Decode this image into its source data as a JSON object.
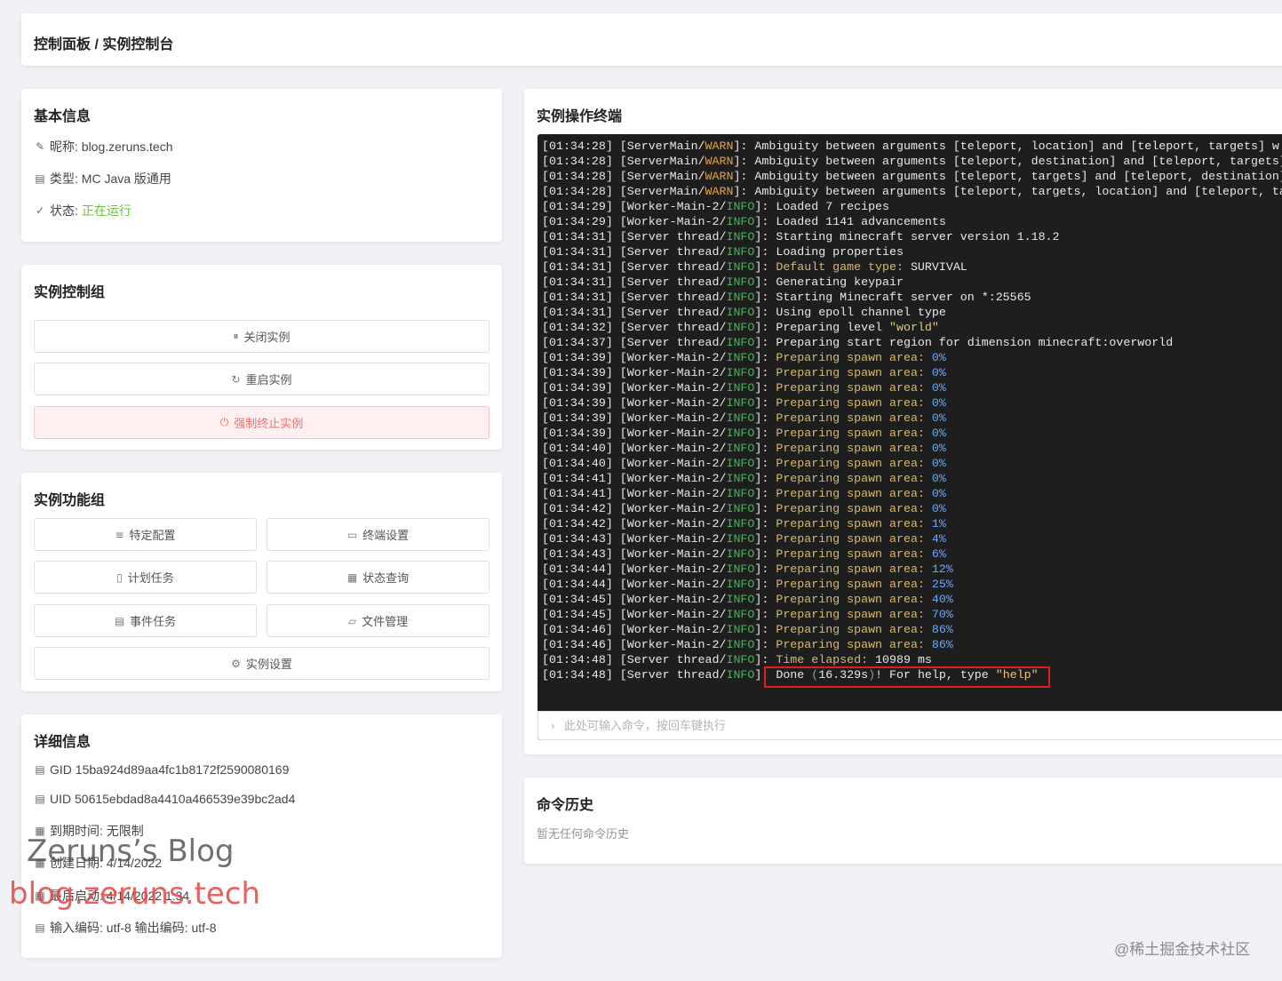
{
  "header": {
    "breadcrumb": "控制面板 / 实例控制台"
  },
  "basic": {
    "title": "基本信息",
    "nickname_label": "昵称: blog.zeruns.tech",
    "type_label": "类型: MC Java 版通用",
    "status_prefix": "状态:",
    "status_value": "正在运行"
  },
  "control": {
    "title": "实例控制组",
    "stop": "关闭实例",
    "restart": "重启实例",
    "kill": "强制终止实例"
  },
  "functions": {
    "title": "实例功能组",
    "items": [
      "特定配置",
      "终端设置",
      "计划任务",
      "状态查询",
      "事件任务",
      "文件管理",
      "实例设置"
    ]
  },
  "detail": {
    "title": "详细信息",
    "gid": "GID 15ba924d89aa4fc1b8172f2590080169",
    "uid": "UID 50615ebdad8a4410a466539e39bc2ad4",
    "expire": "到期时间: 无限制",
    "created": "创建日期: 4/14/2022",
    "last_start": "最后启动: 4/14/2022 1:34",
    "encoding": "输入编码: utf-8 输出编码: utf-8"
  },
  "terminal": {
    "title": "实例操作终端",
    "lines": [
      [
        "[01:34:28]",
        "ServerMain",
        "WARN",
        "Ambiguity between arguments [teleport, location] and [teleport, targets] w",
        "plain"
      ],
      [
        "[01:34:28]",
        "ServerMain",
        "WARN",
        "Ambiguity between arguments [teleport, destination] and [teleport, targets]",
        "plain"
      ],
      [
        "[01:34:28]",
        "ServerMain",
        "WARN",
        "Ambiguity between arguments [teleport, targets] and [teleport, destination]",
        "plain"
      ],
      [
        "[01:34:28]",
        "ServerMain",
        "WARN",
        "Ambiguity between arguments [teleport, targets, location] and [teleport, ta",
        "plain"
      ],
      [
        "[01:34:29]",
        "Worker-Main-2",
        "INFO",
        "Loaded 7 recipes",
        "plain"
      ],
      [
        "[01:34:29]",
        "Worker-Main-2",
        "INFO",
        "Loaded 1141 advancements",
        "plain"
      ],
      [
        "[01:34:31]",
        "Server thread",
        "INFO",
        "Starting minecraft server version 1.18.2",
        "plain"
      ],
      [
        "[01:34:31]",
        "Server thread",
        "INFO",
        "Loading properties",
        "plain"
      ],
      [
        "[01:34:31]",
        "Server thread",
        "INFO",
        "Default game type: |SURVIVAL",
        "gametype"
      ],
      [
        "[01:34:31]",
        "Server thread",
        "INFO",
        "Generating keypair",
        "plain"
      ],
      [
        "[01:34:31]",
        "Server thread",
        "INFO",
        "Starting Minecraft server on *:25565",
        "plain"
      ],
      [
        "[01:34:31]",
        "Server thread",
        "INFO",
        "Using epoll channel type",
        "plain"
      ],
      [
        "[01:34:32]",
        "Server thread",
        "INFO",
        "Preparing level |\"world\"",
        "level"
      ],
      [
        "[01:34:37]",
        "Server thread",
        "INFO",
        "Preparing start region for dimension minecraft:overworld",
        "plain"
      ],
      [
        "[01:34:39]",
        "Worker-Main-2",
        "INFO",
        "Preparing spawn area: |0%",
        "spawn"
      ],
      [
        "[01:34:39]",
        "Worker-Main-2",
        "INFO",
        "Preparing spawn area: |0%",
        "spawn"
      ],
      [
        "[01:34:39]",
        "Worker-Main-2",
        "INFO",
        "Preparing spawn area: |0%",
        "spawn"
      ],
      [
        "[01:34:39]",
        "Worker-Main-2",
        "INFO",
        "Preparing spawn area: |0%",
        "spawn"
      ],
      [
        "[01:34:39]",
        "Worker-Main-2",
        "INFO",
        "Preparing spawn area: |0%",
        "spawn"
      ],
      [
        "[01:34:39]",
        "Worker-Main-2",
        "INFO",
        "Preparing spawn area: |0%",
        "spawn"
      ],
      [
        "[01:34:40]",
        "Worker-Main-2",
        "INFO",
        "Preparing spawn area: |0%",
        "spawn"
      ],
      [
        "[01:34:40]",
        "Worker-Main-2",
        "INFO",
        "Preparing spawn area: |0%",
        "spawn"
      ],
      [
        "[01:34:41]",
        "Worker-Main-2",
        "INFO",
        "Preparing spawn area: |0%",
        "spawn"
      ],
      [
        "[01:34:41]",
        "Worker-Main-2",
        "INFO",
        "Preparing spawn area: |0%",
        "spawn"
      ],
      [
        "[01:34:42]",
        "Worker-Main-2",
        "INFO",
        "Preparing spawn area: |0%",
        "spawn"
      ],
      [
        "[01:34:42]",
        "Worker-Main-2",
        "INFO",
        "Preparing spawn area: |1%",
        "spawn"
      ],
      [
        "[01:34:43]",
        "Worker-Main-2",
        "INFO",
        "Preparing spawn area: |4%",
        "spawn"
      ],
      [
        "[01:34:43]",
        "Worker-Main-2",
        "INFO",
        "Preparing spawn area: |6%",
        "spawn"
      ],
      [
        "[01:34:44]",
        "Worker-Main-2",
        "INFO",
        "Preparing spawn area: |12%",
        "spawn"
      ],
      [
        "[01:34:44]",
        "Worker-Main-2",
        "INFO",
        "Preparing spawn area: |25%",
        "spawn"
      ],
      [
        "[01:34:45]",
        "Worker-Main-2",
        "INFO",
        "Preparing spawn area: |40%",
        "spawn"
      ],
      [
        "[01:34:45]",
        "Worker-Main-2",
        "INFO",
        "Preparing spawn area: |70%",
        "spawn"
      ],
      [
        "[01:34:46]",
        "Worker-Main-2",
        "INFO",
        "Preparing spawn area: |86%",
        "spawn"
      ],
      [
        "[01:34:46]",
        "Worker-Main-2",
        "INFO",
        "Preparing spawn area: |86%",
        "spawn"
      ],
      [
        "[01:34:48]",
        "Server thread",
        "INFO",
        "Time elapsed: |10989 ms",
        "elapsed"
      ],
      [
        "[01:34:48]",
        "Server thread",
        "INFO",
        "Done (16.329s)! For help, type \"help\"",
        "done"
      ]
    ],
    "input_placeholder": "此处可输入命令，按回车键执行",
    "colors": {
      "warn": "#e0a44a",
      "info": "#3fb950",
      "highlight_box": "#e31d1d"
    }
  },
  "history": {
    "title": "命令历史",
    "empty": "暂无任何命令历史"
  },
  "watermarks": {
    "blog_name": "Zeruns’s Blog",
    "blog_url": "blog.zeruns.tech",
    "community": "@稀土掘金技术社区"
  },
  "icons": {
    "nickname": "pencil-icon",
    "type": "document-icon",
    "status": "check-icon",
    "stop": "pause-circle-icon",
    "restart": "refresh-icon",
    "kill": "power-icon",
    "config": "sliders-icon",
    "terminal_settings": "monitor-icon",
    "schedule": "calendar-icon",
    "status_query": "chart-icon",
    "events": "list-icon",
    "files": "folder-icon",
    "settings": "gear-icon"
  },
  "accent": {
    "running": "#67c23a",
    "danger": "#f56c6c"
  }
}
